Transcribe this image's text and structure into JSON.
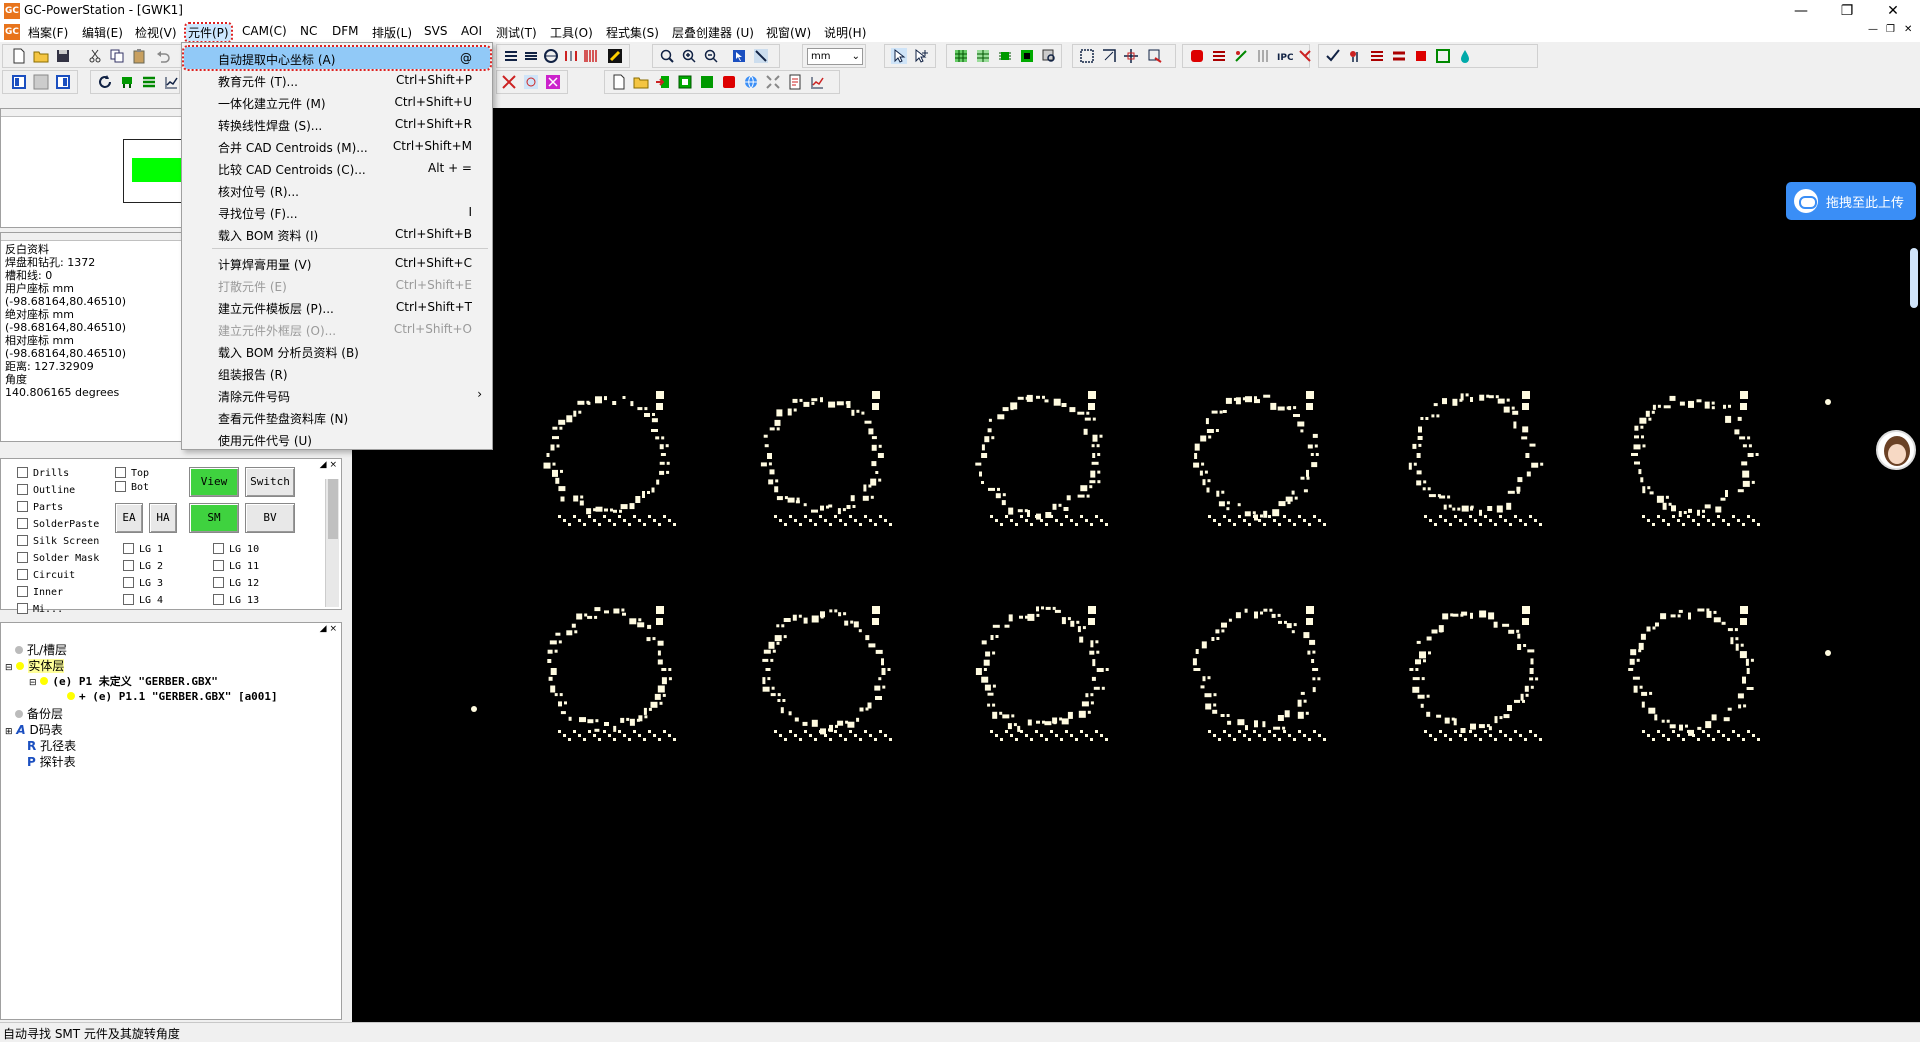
{
  "window": {
    "title": "GC-PowerStation - [GWK1]",
    "app_icon_text": "GC",
    "minimize_icon": "minimize-icon",
    "restore_icon": "restore-icon",
    "close_icon": "close-icon"
  },
  "menubar": {
    "items": [
      "档案(F)",
      "编辑(E)",
      "检视(V)",
      "元件(P)",
      "CAM(C)",
      "NC",
      "DFM",
      "排版(L)",
      "SVS",
      "AOI",
      "测试(T)",
      "工具(O)",
      "程式集(S)",
      "层叠创建器 (U)",
      "视窗(W)",
      "说明(H)"
    ],
    "active_index": 3
  },
  "toolbar": {
    "unit_select": "mm"
  },
  "dropdown": {
    "items": [
      {
        "label": "自动提取中心坐标 (A)",
        "shortcut": "@",
        "state": "highlight"
      },
      {
        "label": "教育元件 (T)...",
        "shortcut": "Ctrl+Shift+P",
        "state": "normal"
      },
      {
        "label": "一体化建立元件 (M)",
        "shortcut": "Ctrl+Shift+U",
        "state": "normal"
      },
      {
        "label": "转换线性焊盘 (S)...",
        "shortcut": "Ctrl+Shift+R",
        "state": "normal"
      },
      {
        "label": "合并 CAD Centroids (M)...",
        "shortcut": "Ctrl+Shift+M",
        "state": "normal"
      },
      {
        "label": "比较 CAD Centroids (C)...",
        "shortcut": "Alt + =",
        "state": "normal"
      },
      {
        "label": "核对位号 (R)...",
        "shortcut": "",
        "state": "normal"
      },
      {
        "label": "寻找位号 (F)...",
        "shortcut": "I",
        "state": "normal"
      },
      {
        "label": "载入 BOM 资料 (I)",
        "shortcut": "Ctrl+Shift+B",
        "state": "normal"
      },
      {
        "label": "计算焊膏用量 (V)",
        "shortcut": "Ctrl+Shift+C",
        "state": "normal",
        "sep_before": true
      },
      {
        "label": "打散元件 (E)",
        "shortcut": "Ctrl+Shift+E",
        "state": "disabled"
      },
      {
        "label": "建立元件模板层 (P)...",
        "shortcut": "Ctrl+Shift+T",
        "state": "normal"
      },
      {
        "label": "建立元件外框层 (O)...",
        "shortcut": "Ctrl+Shift+O",
        "state": "disabled"
      },
      {
        "label": "载入 BOM 分析员资料 (B)",
        "shortcut": "",
        "state": "normal"
      },
      {
        "label": "组装报告 (R)",
        "shortcut": "",
        "state": "normal"
      },
      {
        "label": "清除元件号码",
        "shortcut": "›",
        "state": "normal"
      },
      {
        "label": "查看元件垫盘资料库 (N)",
        "shortcut": "",
        "state": "normal"
      },
      {
        "label": "使用元件代号 (U)",
        "shortcut": "",
        "state": "normal"
      }
    ]
  },
  "info": {
    "lines": [
      "反白资料",
      " 焊盘和钻孔: 1372",
      " 槽和线: 0",
      "用户座标 mm",
      "(-98.68164,80.46510)",
      "绝对座标 mm",
      "(-98.68164,80.46510)",
      "相对座标 mm",
      " (-98.68164,80.46510)",
      " 距离: 127.32909",
      "角度",
      " 140.806165 degrees"
    ]
  },
  "layers": {
    "left": [
      "Drills",
      "Outline",
      "Parts",
      "SolderPaste",
      "Silk Screen",
      "Solder Mask",
      "Circuit",
      "Inner",
      "Mi..."
    ],
    "sides": [
      "Top",
      "Bot"
    ],
    "btn_view": "View",
    "btn_switch": "Switch",
    "btn_ea": "EA",
    "btn_ha": "HA",
    "btn_sm": "SM",
    "btn_bv": "BV",
    "lg_col1": [
      "LG 1",
      "LG 2",
      "LG 3",
      "LG 4"
    ],
    "lg_col2": [
      "LG 10",
      "LG 11",
      "LG 12",
      "LG 13"
    ]
  },
  "tree": {
    "hole_layer": "孔/槽层",
    "solid_layer": "实体层",
    "p1": "(e) P1 未定义 \"GERBER.GBX\"",
    "p11": "+ (e) P1.1 \"GERBER.GBX\" [a001]",
    "backup_layer": "备份层",
    "dcode": "D码表",
    "drill": "孔径表",
    "probe": "探针表"
  },
  "upload": {
    "label": "拖拽至此上传"
  },
  "status": {
    "text": "自动寻找 SMT 元件及其旋转角度"
  },
  "colors": {
    "canvas": "#000000",
    "pad": "#fffbe0",
    "accent_green": "#3fd23f",
    "highlight_blue": "#91c9f7",
    "annotation_red": "#dd2222"
  }
}
